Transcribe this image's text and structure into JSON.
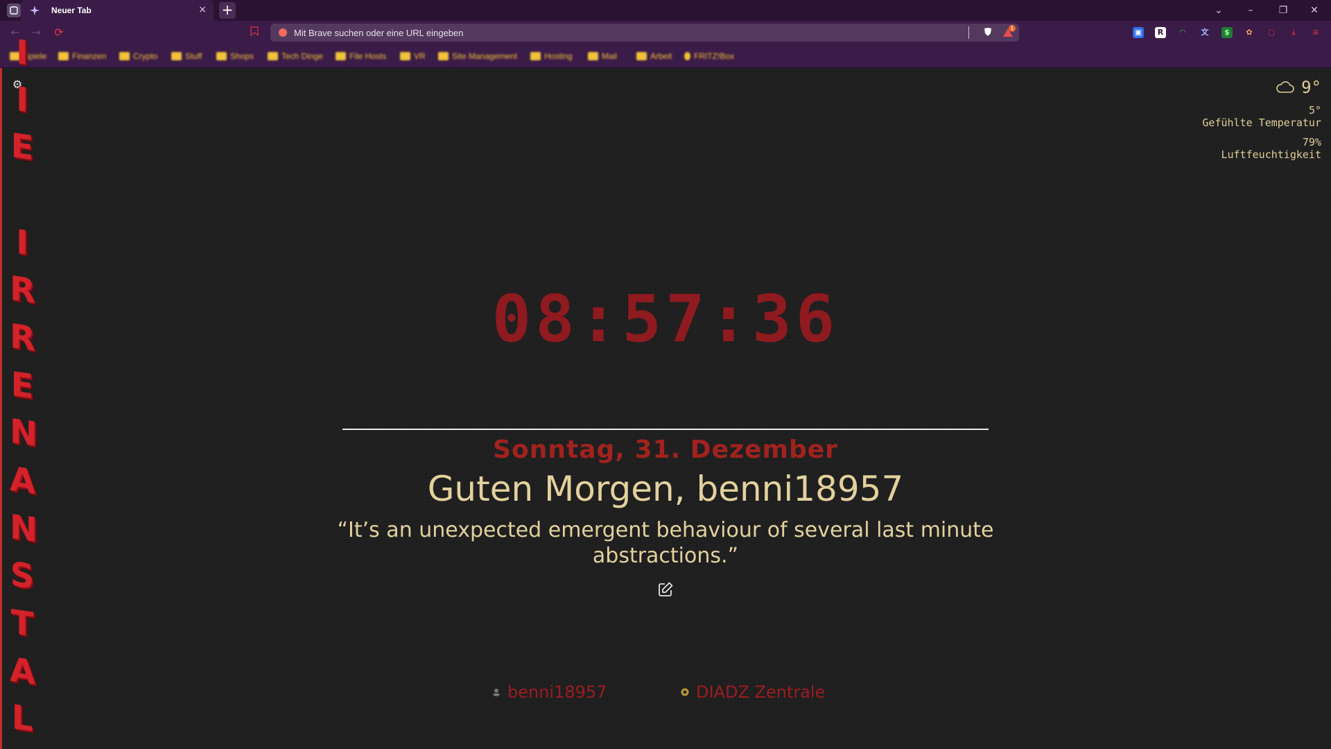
{
  "browser": {
    "tab_title": "Neuer Tab",
    "tab_close": "×",
    "new_tab": "+",
    "address_placeholder": "Mit Brave suchen oder eine URL eingeben",
    "rewards_badge": "1",
    "window_controls": {
      "tabs_menu": "⌄",
      "minimize": "–",
      "restore": "❐",
      "close": "✕"
    }
  },
  "bookmarks": [
    {
      "label": "Spiele"
    },
    {
      "label": "Finanzen"
    },
    {
      "label": "Crypto"
    },
    {
      "label": "Stuff"
    },
    {
      "label": "Shops"
    },
    {
      "label": "Tech Dinge"
    },
    {
      "label": "File Hosts"
    },
    {
      "label": "VR"
    },
    {
      "label": "Site Management"
    },
    {
      "label": "Hosting"
    },
    {
      "label": "Mail"
    },
    {
      "label": "Arbeit"
    },
    {
      "label": "FRITZ!Box"
    }
  ],
  "sidebar": {
    "letters_top": [
      "I",
      "E"
    ],
    "letters_main": [
      "I",
      "R",
      "R",
      "E",
      "N",
      "A",
      "N",
      "S",
      "T",
      "A",
      "L"
    ]
  },
  "weather": {
    "icon": "cloud-icon",
    "temperature": "9°",
    "feels_like_value": "5°",
    "feels_like_label": "Gefühlte Temperatur",
    "humidity_value": "79%",
    "humidity_label": "Luftfeuchtigkeit"
  },
  "main": {
    "time": "08:57:36",
    "date": "Sonntag, 31. Dezember",
    "greeting": "Guten Morgen, benni18957",
    "quote": "“It’s an unexpected emergent behaviour of several last minute abstractions.”"
  },
  "links": [
    {
      "label": "benni18957",
      "icon": "user-icon"
    },
    {
      "label": "DIADZ Zentrale",
      "icon": "site-icon"
    }
  ],
  "colors": {
    "accent_red": "#c42b2b",
    "clock": "#8f1a1f",
    "gold_text": "#e3d19e",
    "chrome_purple": "#3b1b47"
  }
}
